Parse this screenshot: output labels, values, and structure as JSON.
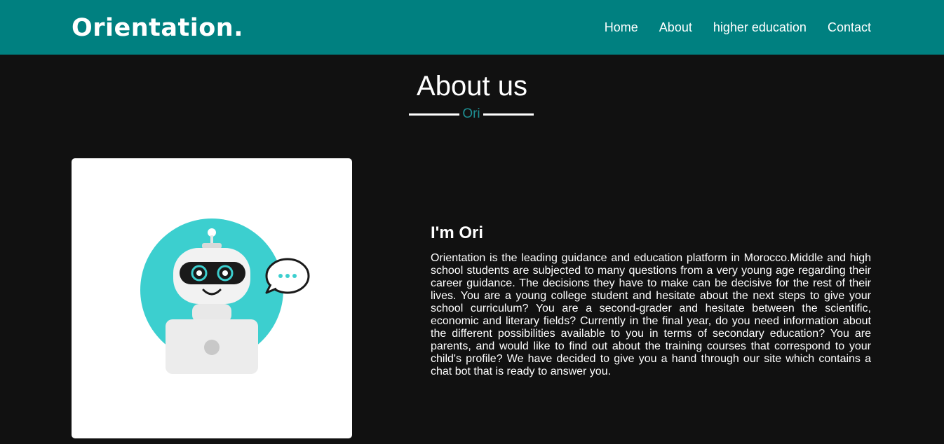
{
  "header": {
    "logo": "Orientation.",
    "nav": [
      {
        "label": "Home"
      },
      {
        "label": "About"
      },
      {
        "label": "higher education"
      },
      {
        "label": "Contact"
      }
    ]
  },
  "section": {
    "title": "About us",
    "subtitle": "Ori"
  },
  "about": {
    "image_label": "robot-assistant-illustration",
    "heading": "I'm Ori",
    "body": "Orientation is the leading guidance and education platform in Morocco.Middle and high school students are subjected to many questions from a very young age regarding their career guidance. The decisions they have to make can be decisive for the rest of their lives. You are a young college student and hesitate about the next steps to give your school curriculum? You are a second-grader and hesitate between the scientific, economic and literary fields? Currently in the final year, do you need information about the different possibilities available to you in terms of secondary education? You are parents, and would like to find out about the training courses that correspond to your child's profile? We have decided to give you a hand through our site which contains a chat bot that is ready to answer you."
  },
  "colors": {
    "navbar": "#008080",
    "background": "#111111",
    "accent": "#1e8f93",
    "robot_circle": "#3ccfcf"
  }
}
